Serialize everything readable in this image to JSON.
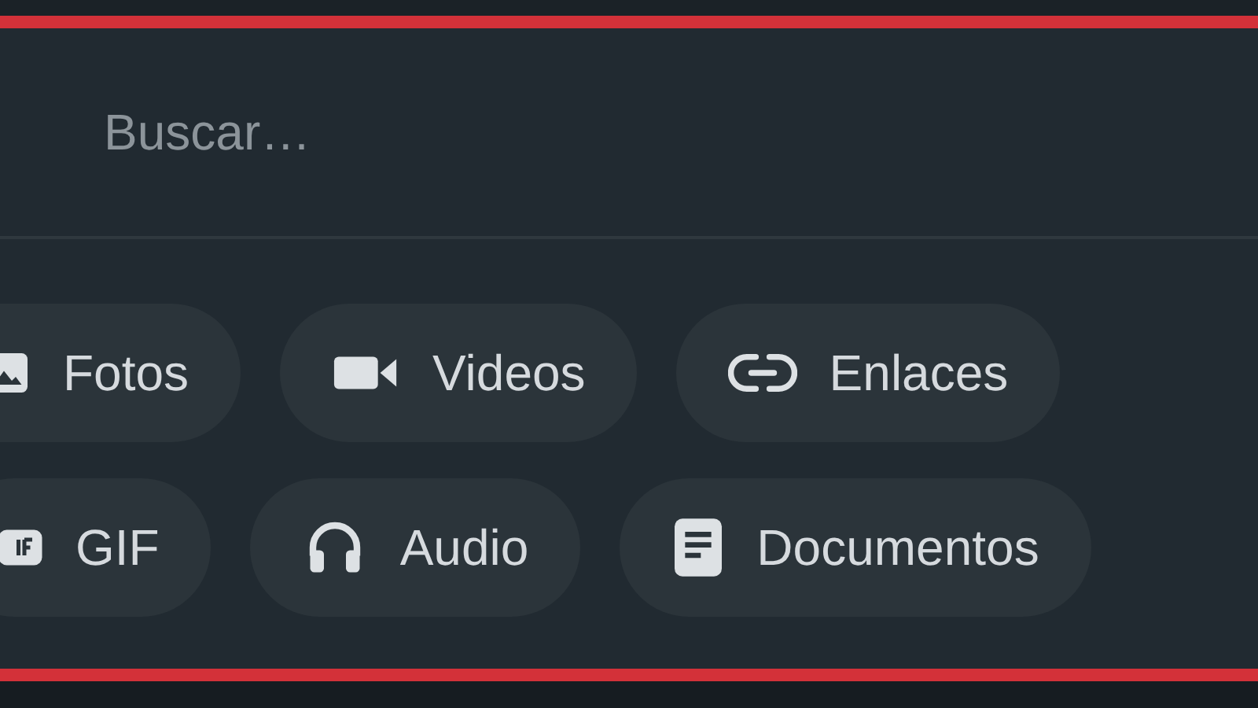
{
  "search": {
    "placeholder": "Buscar…"
  },
  "filter_rows": [
    [
      {
        "kind": "photo",
        "label": "Fotos"
      },
      {
        "kind": "video",
        "label": "Videos"
      },
      {
        "kind": "link",
        "label": "Enlaces"
      }
    ],
    [
      {
        "kind": "gif",
        "label": "GIF"
      },
      {
        "kind": "audio",
        "label": "Audio"
      },
      {
        "kind": "document",
        "label": "Documentos"
      }
    ]
  ]
}
